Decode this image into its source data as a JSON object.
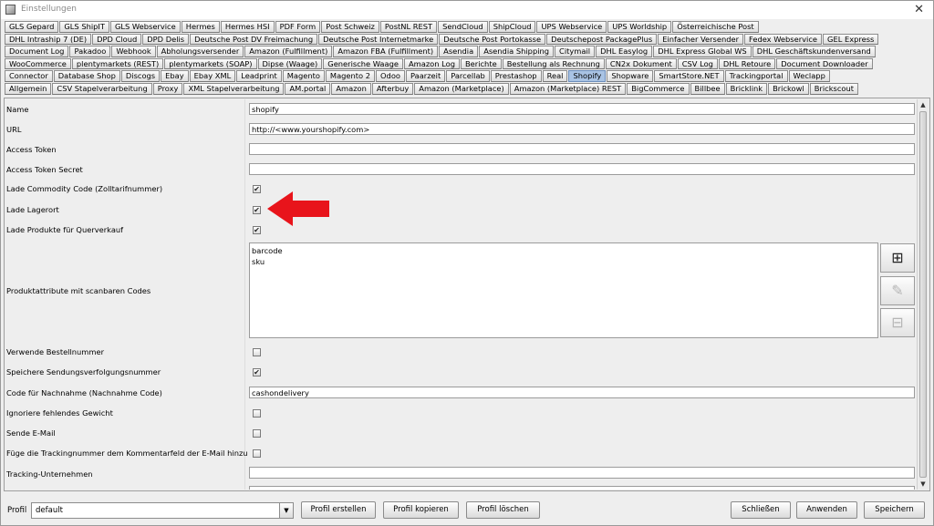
{
  "window": {
    "title": "Einstellungen",
    "close_glyph": "✕"
  },
  "tabs": {
    "rows": [
      [
        "GLS Gepard",
        "GLS ShipIT",
        "GLS Webservice",
        "Hermes",
        "Hermes HSI",
        "PDF Form",
        "Post Schweiz",
        "PostNL REST",
        "SendCloud",
        "ShipCloud",
        "UPS Webservice",
        "UPS Worldship",
        "Österreichische Post"
      ],
      [
        "DHL Intraship 7 (DE)",
        "DPD Cloud",
        "DPD Delis",
        "Deutsche Post DV Freimachung",
        "Deutsche Post Internetmarke",
        "Deutsche Post Portokasse",
        "Deutschepost PackagePlus",
        "Einfacher Versender",
        "Fedex Webservice",
        "GEL Express"
      ],
      [
        "Document Log",
        "Pakadoo",
        "Webhook",
        "Abholungsversender",
        "Amazon (Fulfillment)",
        "Amazon FBA (Fulfillment)",
        "Asendia",
        "Asendia Shipping",
        "Citymail",
        "DHL Easylog",
        "DHL Express Global WS",
        "DHL Geschäftskundenversand"
      ],
      [
        "WooCommerce",
        "plentymarkets (REST)",
        "plentymarkets (SOAP)",
        "Dipse (Waage)",
        "Generische Waage",
        "Amazon Log",
        "Berichte",
        "Bestellung als Rechnung",
        "CN2x Dokument",
        "CSV Log",
        "DHL Retoure",
        "Document Downloader"
      ],
      [
        "Connector",
        "Database Shop",
        "Discogs",
        "Ebay",
        "Ebay XML",
        "Leadprint",
        "Magento",
        "Magento 2",
        "Odoo",
        "Paarzeit",
        "Parcellab",
        "Prestashop",
        "Real",
        "Shopify",
        "Shopware",
        "SmartStore.NET",
        "Trackingportal",
        "Weclapp"
      ],
      [
        "Allgemein",
        "CSV Stapelverarbeitung",
        "Proxy",
        "XML Stapelverarbeitung",
        "AM.portal",
        "Amazon",
        "Afterbuy",
        "Amazon (Marketplace)",
        "Amazon (Marketplace) REST",
        "BigCommerce",
        "Billbee",
        "Bricklink",
        "Brickowl",
        "Brickscout"
      ]
    ],
    "active": "Shopify"
  },
  "form": {
    "name": {
      "label": "Name",
      "value": "shopify"
    },
    "url": {
      "label": "URL",
      "value": "http://<www.yourshopify.com>"
    },
    "access_token": {
      "label": "Access Token",
      "value": ""
    },
    "access_token_secret": {
      "label": "Access Token Secret",
      "value": ""
    },
    "commodity_code": {
      "label": "Lade Commodity Code (Zolltarifnummer)",
      "checked": true
    },
    "lagerort": {
      "label": "Lade Lagerort",
      "checked": true
    },
    "querverkauf": {
      "label": "Lade Produkte für Querverkauf",
      "checked": true
    },
    "produktattribute": {
      "label": "Produktattribute mit scanbaren Codes",
      "items": [
        "barcode",
        "sku"
      ]
    },
    "bestellnummer": {
      "label": "Verwende Bestellnummer",
      "checked": false
    },
    "sendungsverfolgung": {
      "label": "Speichere Sendungsverfolgungsnummer",
      "checked": true
    },
    "nachnahme": {
      "label": "Code für Nachnahme (Nachnahme Code)",
      "value": "cashondelivery"
    },
    "gewicht": {
      "label": "Ignoriere fehlendes Gewicht",
      "checked": false
    },
    "email": {
      "label": "Sende E-Mail",
      "checked": false
    },
    "trackingnummer": {
      "label": "Füge die Trackingnummer dem Kommentarfeld der E-Mail hinzu",
      "checked": false
    },
    "tracking_unternehmen": {
      "label": "Tracking-Unternehmen",
      "value": ""
    }
  },
  "list_buttons": {
    "add_glyph": "⊞",
    "edit_glyph": "✎",
    "remove_glyph": "⊟"
  },
  "checkbox_glyph": "✔",
  "scroll": {
    "up": "▲",
    "down": "▼"
  },
  "bottom": {
    "profil_label": "Profil",
    "profil_value": "default",
    "dropdown_glyph": "▼",
    "profil_erstellen": "Profil erstellen",
    "profil_kopieren": "Profil kopieren",
    "profil_loeschen": "Profil löschen",
    "schliessen": "Schließen",
    "anwenden": "Anwenden",
    "speichern": "Speichern"
  },
  "colors": {
    "annotation_arrow": "#e8141b",
    "active_tab": "#a9c3e4"
  }
}
